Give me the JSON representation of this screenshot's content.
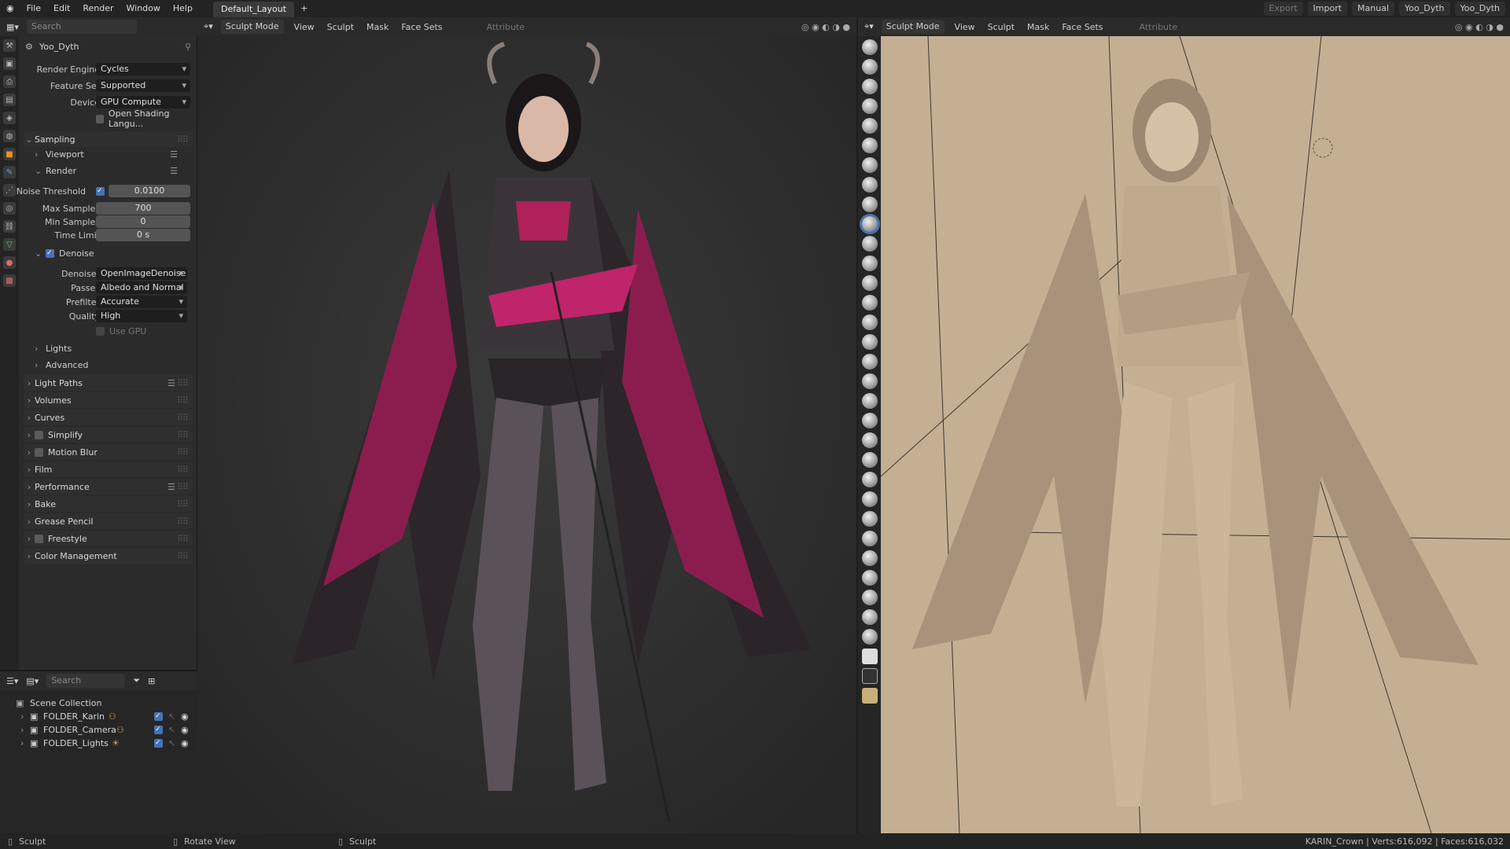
{
  "menu": {
    "items": [
      "File",
      "Edit",
      "Render",
      "Window",
      "Help"
    ],
    "workspace_tab": "Default_Layout",
    "add_tab": "+"
  },
  "topright": {
    "export": "Export",
    "import": "Import",
    "manual": "Manual",
    "scene": "Yoo_Dyth",
    "viewlayer": "Yoo_Dyth"
  },
  "editor_header": {
    "search_placeholder": "Search"
  },
  "viewport_left": {
    "mode": "Sculpt Mode",
    "menus": [
      "View",
      "Sculpt",
      "Mask",
      "Face Sets"
    ],
    "attribute": "Attribute"
  },
  "viewport_right": {
    "mode": "Sculpt Mode",
    "menus": [
      "View",
      "Sculpt",
      "Mask",
      "Face Sets"
    ],
    "attribute": "Attribute"
  },
  "props": {
    "object_name": "Yoo_Dyth",
    "render_engine": {
      "label": "Render Engine",
      "value": "Cycles"
    },
    "feature_set": {
      "label": "Feature Set",
      "value": "Supported"
    },
    "device": {
      "label": "Device",
      "value": "GPU Compute"
    },
    "osl": "Open Shading Langu...",
    "sampling": "Sampling",
    "viewport": "Viewport",
    "render": "Render",
    "noise_threshold": {
      "label": "Noise Threshold",
      "value": "0.0100"
    },
    "max_samples": {
      "label": "Max Samples",
      "value": "700"
    },
    "min_samples": {
      "label": "Min Samples",
      "value": "0"
    },
    "time_limit": {
      "label": "Time Limit",
      "value": "0 s"
    },
    "denoise": "Denoise",
    "denoiser": {
      "label": "Denoiser",
      "value": "OpenImageDenoise"
    },
    "passes": {
      "label": "Passes",
      "value": "Albedo and Normal"
    },
    "prefilter": {
      "label": "Prefilter",
      "value": "Accurate"
    },
    "quality": {
      "label": "Quality",
      "value": "High"
    },
    "use_gpu": "Use GPU",
    "lights": "Lights",
    "advanced": "Advanced",
    "sections": [
      "Light Paths",
      "Volumes",
      "Curves",
      "Simplify",
      "Motion Blur",
      "Film",
      "Performance",
      "Bake",
      "Grease Pencil",
      "Freestyle",
      "Color Management"
    ]
  },
  "outliner": {
    "search_placeholder": "Search",
    "root": "Scene Collection",
    "items": [
      "FOLDER_Karin",
      "FOLDER_Camera",
      "FOLDER_Lights"
    ]
  },
  "status": {
    "left": "Sculpt",
    "mid": "Rotate View",
    "mid2": "Sculpt",
    "right": "KARIN_Crown | Verts:616,092 | Faces:616,032"
  },
  "colors": {
    "accent": "#4772b3",
    "clay": "#c5af93",
    "magenta": "#b0205a"
  }
}
